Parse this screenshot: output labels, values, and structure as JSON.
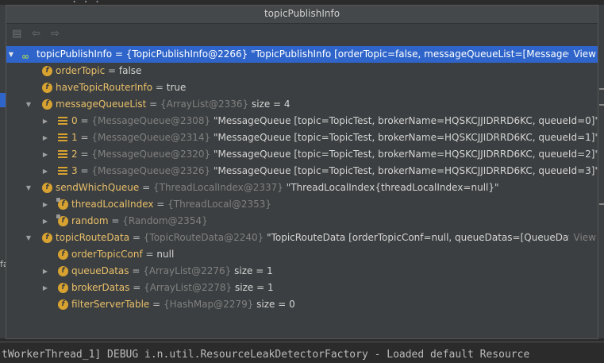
{
  "window": {
    "title": "topicPublishInfo"
  },
  "toolbar": {
    "icons": [
      "folder-icon",
      "back-arrow-icon",
      "forward-arrow-icon"
    ]
  },
  "tree": {
    "root": {
      "name": "topicPublishInfo",
      "eq": " = ",
      "ref": "{TopicPublishInfo@2266}",
      "value": " \"TopicPublishInfo [orderTopic=false, messageQueueList=[MessageQ...",
      "view": "View"
    },
    "orderTopic": {
      "name": "orderTopic",
      "eq": " = ",
      "value": "false"
    },
    "haveTopicRouterInfo": {
      "name": "haveTopicRouterInfo",
      "eq": " = ",
      "value": "true"
    },
    "messageQueueList": {
      "name": "messageQueueList",
      "eq": " = ",
      "ref": "{ArrayList@2336}",
      "value": "  size = 4"
    },
    "mq": [
      {
        "index": "0",
        "eq": " = ",
        "ref": "{MessageQueue@2308}",
        "value": " \"MessageQueue [topic=TopicTest, brokerName=HQSKCJJIDRRD6KC, queueId=0]\""
      },
      {
        "index": "1",
        "eq": " = ",
        "ref": "{MessageQueue@2314}",
        "value": " \"MessageQueue [topic=TopicTest, brokerName=HQSKCJJIDRRD6KC, queueId=1]\""
      },
      {
        "index": "2",
        "eq": " = ",
        "ref": "{MessageQueue@2320}",
        "value": " \"MessageQueue [topic=TopicTest, brokerName=HQSKCJJIDRRD6KC, queueId=2]\""
      },
      {
        "index": "3",
        "eq": " = ",
        "ref": "{MessageQueue@2326}",
        "value": " \"MessageQueue [topic=TopicTest, brokerName=HQSKCJJIDRRD6KC, queueId=3]\""
      }
    ],
    "sendWhichQueue": {
      "name": "sendWhichQueue",
      "eq": " = ",
      "ref": "{ThreadLocalIndex@2337}",
      "value": " \"ThreadLocalIndex{threadLocalIndex=null}\""
    },
    "threadLocalIndex": {
      "name": "threadLocalIndex",
      "eq": " = ",
      "ref": "{ThreadLocal@2353}"
    },
    "random": {
      "name": "random",
      "eq": " = ",
      "ref": "{Random@2354}"
    },
    "topicRouteData": {
      "name": "topicRouteData",
      "eq": " = ",
      "ref": "{TopicRouteData@2240}",
      "value": " \"TopicRouteData [orderTopicConf=null, queueDatas=[QueueData [...",
      "view": "View"
    },
    "orderTopicConf": {
      "name": "orderTopicConf",
      "eq": " = ",
      "value": "null"
    },
    "queueDatas": {
      "name": "queueDatas",
      "eq": " = ",
      "ref": "{ArrayList@2276}",
      "value": "  size = 1"
    },
    "brokerDatas": {
      "name": "brokerDatas",
      "eq": " = ",
      "ref": "{ArrayList@2278}",
      "value": "  size = 1"
    },
    "filterServerTable": {
      "name": "filterServerTable",
      "eq": " = ",
      "ref": "{HashMap@2279}",
      "value": "  size = 0"
    }
  },
  "console": {
    "text": "tWorkerThread_1] DEBUG i.n.util.ResourceLeakDetectorFactory - Loaded default Resource"
  },
  "colors": {
    "selection": "#2f65ca",
    "field_name": "#e8bf6a",
    "field_icon": "#d7a230",
    "ref": "#808080",
    "panel": "#3c3f41"
  }
}
